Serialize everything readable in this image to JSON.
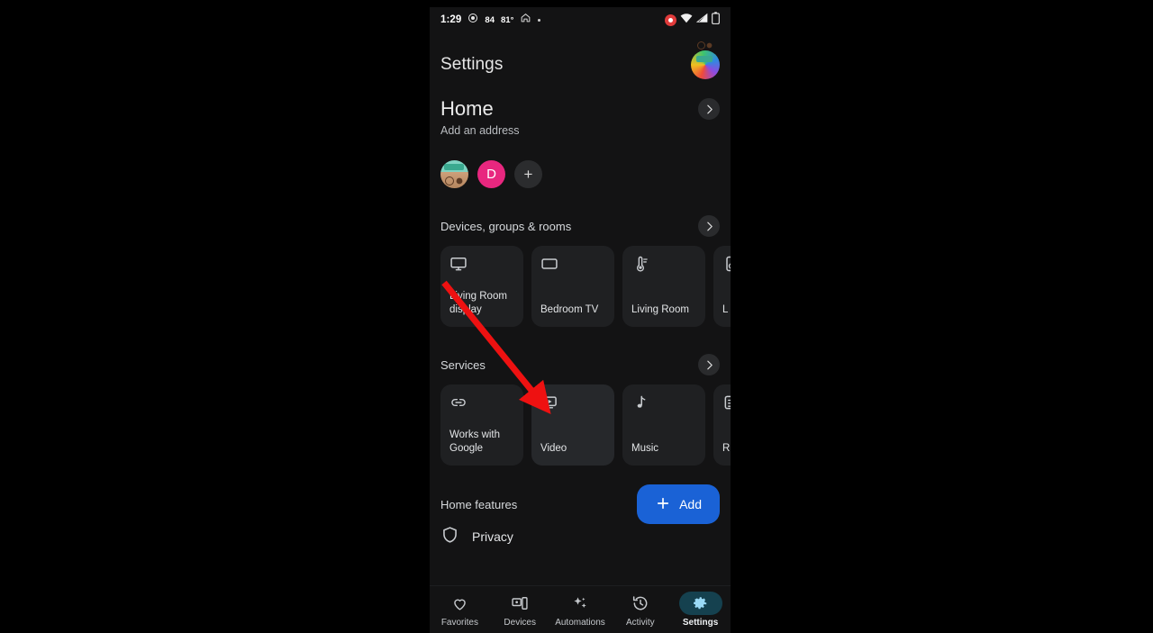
{
  "statusbar": {
    "time": "1:29",
    "record_icon": "record-dot-icon",
    "badge_count": "84",
    "temperature": "81°",
    "home_icon": "home-icon",
    "separator_dot": "•",
    "recording_icon": "screen-recording-icon",
    "wifi_icon": "wifi-icon",
    "signal_icon": "cellular-signal-icon",
    "battery_icon": "battery-icon"
  },
  "header": {
    "title": "Settings",
    "avatar_name": "account-avatar"
  },
  "home": {
    "title": "Home",
    "address": "Add an address",
    "chevron_icon": "chevron-right-icon",
    "members": [
      {
        "type": "photo",
        "label": ""
      },
      {
        "type": "letter",
        "label": "D"
      },
      {
        "type": "add",
        "label": "+"
      }
    ]
  },
  "devices_section": {
    "title": "Devices, groups & rooms",
    "chevron_icon": "chevron-right-icon",
    "cards": [
      {
        "label": "Living Room display",
        "icon": "monitor-icon"
      },
      {
        "label": "Bedroom TV",
        "icon": "tv-icon"
      },
      {
        "label": "Living Room",
        "icon": "thermostat-icon"
      },
      {
        "label": "L S",
        "icon": "speaker-icon"
      }
    ]
  },
  "services_section": {
    "title": "Services",
    "chevron_icon": "chevron-right-icon",
    "cards": [
      {
        "label": "Works with Google",
        "icon": "link-icon"
      },
      {
        "label": "Video",
        "icon": "video-play-icon"
      },
      {
        "label": "Music",
        "icon": "music-note-icon"
      },
      {
        "label": "R",
        "icon": "routines-icon"
      }
    ]
  },
  "home_features": {
    "title": "Home features",
    "add_label": "Add",
    "add_icon": "plus-icon",
    "items": [
      {
        "label": "Privacy",
        "icon": "shield-icon"
      }
    ]
  },
  "bottomnav": {
    "items": [
      {
        "label": "Favorites",
        "icon": "heart-icon",
        "active": false
      },
      {
        "label": "Devices",
        "icon": "devices-icon",
        "active": false
      },
      {
        "label": "Automations",
        "icon": "sparkles-icon",
        "active": false
      },
      {
        "label": "Activity",
        "icon": "history-icon",
        "active": false
      },
      {
        "label": "Settings",
        "icon": "gear-icon",
        "active": true
      }
    ]
  },
  "annotation": {
    "arrow_color": "#ee1111",
    "arrow_name": "red-pointer-arrow"
  }
}
